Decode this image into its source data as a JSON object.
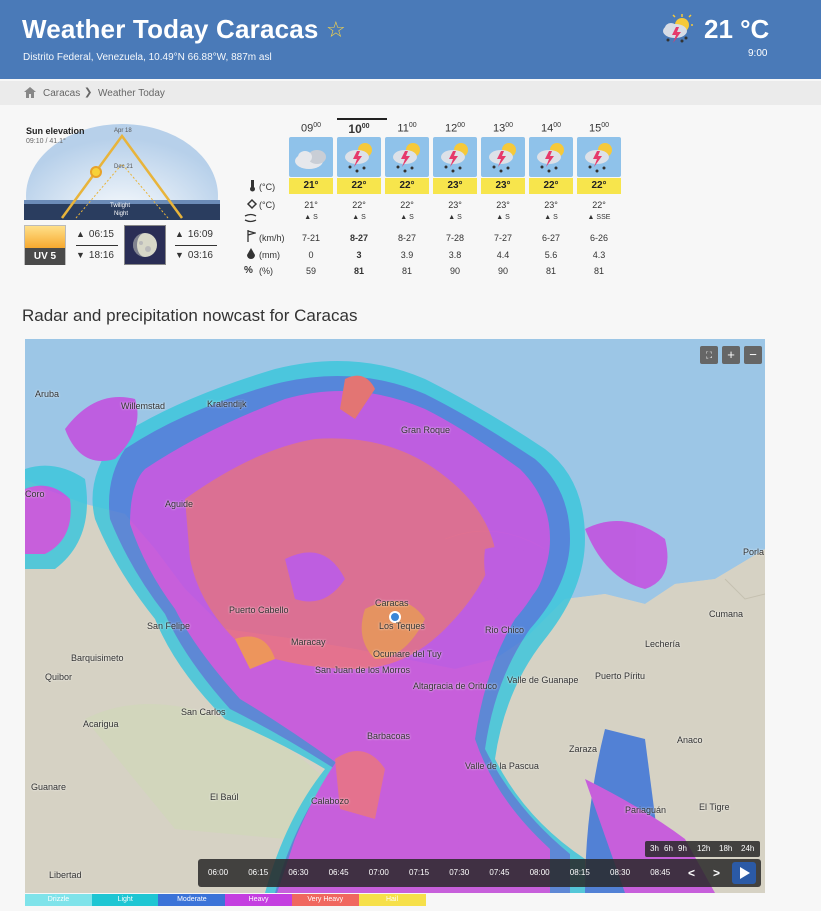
{
  "header": {
    "title": "Weather Today Caracas",
    "location": "Distrito Federal, Venezuela, 10.49°N 66.88°W, 887m asl",
    "temperature": "21 °C",
    "time": "9:00",
    "icon": "thunderstorm-icon"
  },
  "breadcrumb": {
    "items": [
      "Caracas",
      "Weather Today"
    ]
  },
  "sun": {
    "label": "Sun elevation",
    "sublabel": "09:10 / 41.1°",
    "apr_label": "Apr 18",
    "dec_label": "Dec 21",
    "twilight": "Twilight",
    "night": "Night",
    "sunrise": "06:15",
    "sunset": "18:16",
    "uv": "UV 5",
    "moonrise": "16:09",
    "moonset": "03:16"
  },
  "forecast": {
    "hours": [
      {
        "h": "09",
        "m": "00",
        "temp": "21°",
        "felt": "21°",
        "wind_dir": "S",
        "wind": "7-21",
        "rain": "0",
        "prob": "59",
        "icon": "cloudy-icon",
        "current": false
      },
      {
        "h": "10",
        "m": "00",
        "temp": "22°",
        "felt": "22°",
        "wind_dir": "S",
        "wind": "8-27",
        "rain": "3",
        "prob": "81",
        "icon": "thunderstorm-icon",
        "current": true
      },
      {
        "h": "11",
        "m": "00",
        "temp": "22°",
        "felt": "22°",
        "wind_dir": "S",
        "wind": "8-27",
        "rain": "3.9",
        "prob": "81",
        "icon": "thunderstorm-icon",
        "current": false
      },
      {
        "h": "12",
        "m": "00",
        "temp": "23°",
        "felt": "23°",
        "wind_dir": "S",
        "wind": "7-28",
        "rain": "3.8",
        "prob": "90",
        "icon": "thunderstorm-icon",
        "current": false
      },
      {
        "h": "13",
        "m": "00",
        "temp": "23°",
        "felt": "23°",
        "wind_dir": "S",
        "wind": "7-27",
        "rain": "4.4",
        "prob": "90",
        "icon": "thunderstorm-icon",
        "current": false
      },
      {
        "h": "14",
        "m": "00",
        "temp": "22°",
        "felt": "23°",
        "wind_dir": "S",
        "wind": "6-27",
        "rain": "5.6",
        "prob": "81",
        "icon": "thunderstorm-icon",
        "current": false
      },
      {
        "h": "15",
        "m": "00",
        "temp": "22°",
        "felt": "22°",
        "wind_dir": "SSE",
        "wind": "6-26",
        "rain": "4.3",
        "prob": "81",
        "icon": "thunderstorm-icon",
        "current": false
      }
    ],
    "labels": {
      "temp": "(°C)",
      "felt": "(°C)",
      "wind": "(km/h)",
      "rain": "(mm)",
      "prob": "(%)"
    }
  },
  "radar": {
    "heading": "Radar and precipitation nowcast for Caracas",
    "places": [
      "Willemstad",
      "Aruba",
      "Kralendijk",
      "Gran Roque",
      "Coro",
      "Aguide",
      "Puerto Cabello",
      "Caracas",
      "Los Teques",
      "San Felipe",
      "Maracay",
      "Rio Chico",
      "Barquisimeto",
      "San Juan de los Morros",
      "Ocumare del Tuy",
      "Quibor",
      "Altagracia de Orituco",
      "Valle de Guanape",
      "Puerto Píritu",
      "Lechería",
      "Cumana",
      "Porla",
      "Acarigua",
      "San Carlos",
      "Barbacoas",
      "Anaco",
      "Zaraza",
      "Guanare",
      "Valle de la Pascua",
      "El Baúl",
      "Calabozo",
      "Pariaguán",
      "El Tigre",
      "Libertad"
    ],
    "times": [
      "06:00",
      "06:15",
      "06:30",
      "06:45",
      "07:00",
      "07:15",
      "07:30",
      "07:45",
      "08:00",
      "08:15",
      "08:30",
      "08:45"
    ],
    "ranges": [
      "3h",
      "6h",
      "9h",
      "12h",
      "18h",
      "24h"
    ],
    "legend": [
      {
        "label": "Drizzle",
        "color": "#7fe3ea"
      },
      {
        "label": "Light",
        "color": "#1ec6d3"
      },
      {
        "label": "Moderate",
        "color": "#3b73d8"
      },
      {
        "label": "Heavy",
        "color": "#c43ee0"
      },
      {
        "label": "Very Heavy",
        "color": "#f0675f"
      },
      {
        "label": "Hail",
        "color": "#f6e04a"
      }
    ]
  }
}
